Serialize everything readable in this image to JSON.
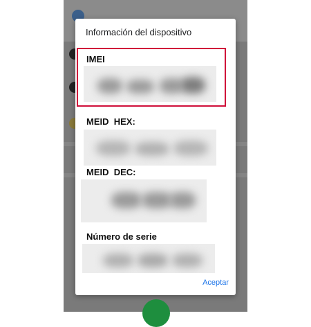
{
  "dialog": {
    "title": "Información del dispositivo",
    "fields": [
      {
        "label": "IMEI",
        "value_redacted": true
      },
      {
        "label": "MEID  HEX:",
        "value_redacted": true
      },
      {
        "label": "MEID  DEC:",
        "value_redacted": true
      },
      {
        "label": "Número de serie",
        "value_redacted": true
      }
    ],
    "accept_label": "Aceptar"
  },
  "colors": {
    "highlight_border": "#d0103a",
    "accent": "#1a73e8",
    "backdrop": "#7a7a7a",
    "fab": "#1e8e3e"
  }
}
